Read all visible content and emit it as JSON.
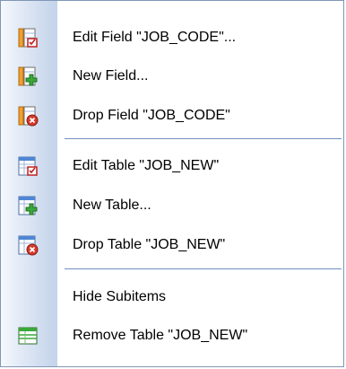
{
  "menu": {
    "items": [
      {
        "label": "Edit Field \"JOB_CODE\"...",
        "icon": "edit-field-icon"
      },
      {
        "label": "New Field...",
        "icon": "new-field-icon"
      },
      {
        "label": "Drop Field \"JOB_CODE\"",
        "icon": "drop-field-icon"
      },
      {
        "label": "Edit Table \"JOB_NEW\"",
        "icon": "edit-table-icon"
      },
      {
        "label": "New Table...",
        "icon": "new-table-icon"
      },
      {
        "label": "Drop Table \"JOB_NEW\"",
        "icon": "drop-table-icon"
      },
      {
        "label": "Hide Subitems",
        "icon": ""
      },
      {
        "label": "Remove Table \"JOB_NEW\"",
        "icon": "remove-table-icon"
      }
    ]
  },
  "colors": {
    "orange": "#f0a030",
    "green": "#3aa83a",
    "red": "#d63a2a",
    "blue": "#4f86d6",
    "separator": "#6f8fc0"
  }
}
